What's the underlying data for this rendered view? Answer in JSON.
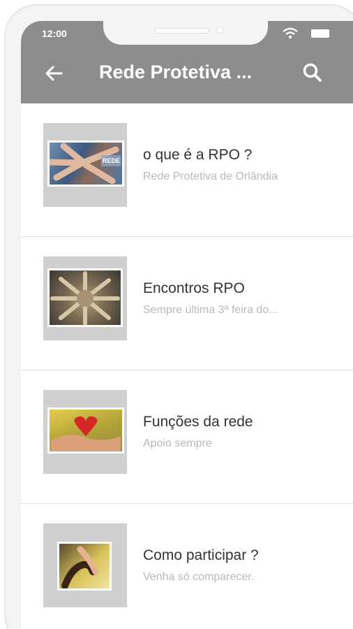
{
  "status_bar": {
    "time": "12:00",
    "wifi_icon": "wifi-icon",
    "battery_icon": "battery-icon"
  },
  "app_bar": {
    "title": "Rede Protetiva ...",
    "back_icon": "arrow-left-icon",
    "search_icon": "search-icon",
    "color": "#8d8d8d"
  },
  "items": [
    {
      "title": "o que é a RPO ?",
      "subtitle": "Rede Protetiva de Orlândia",
      "thumb_text": "REDE"
    },
    {
      "title": "Encontros RPO",
      "subtitle": "Sempre última 3ª feira do..."
    },
    {
      "title": "Funções da rede",
      "subtitle": "Apoio sempre"
    },
    {
      "title": "Como participar ?",
      "subtitle": "Venha só comparecer."
    }
  ]
}
